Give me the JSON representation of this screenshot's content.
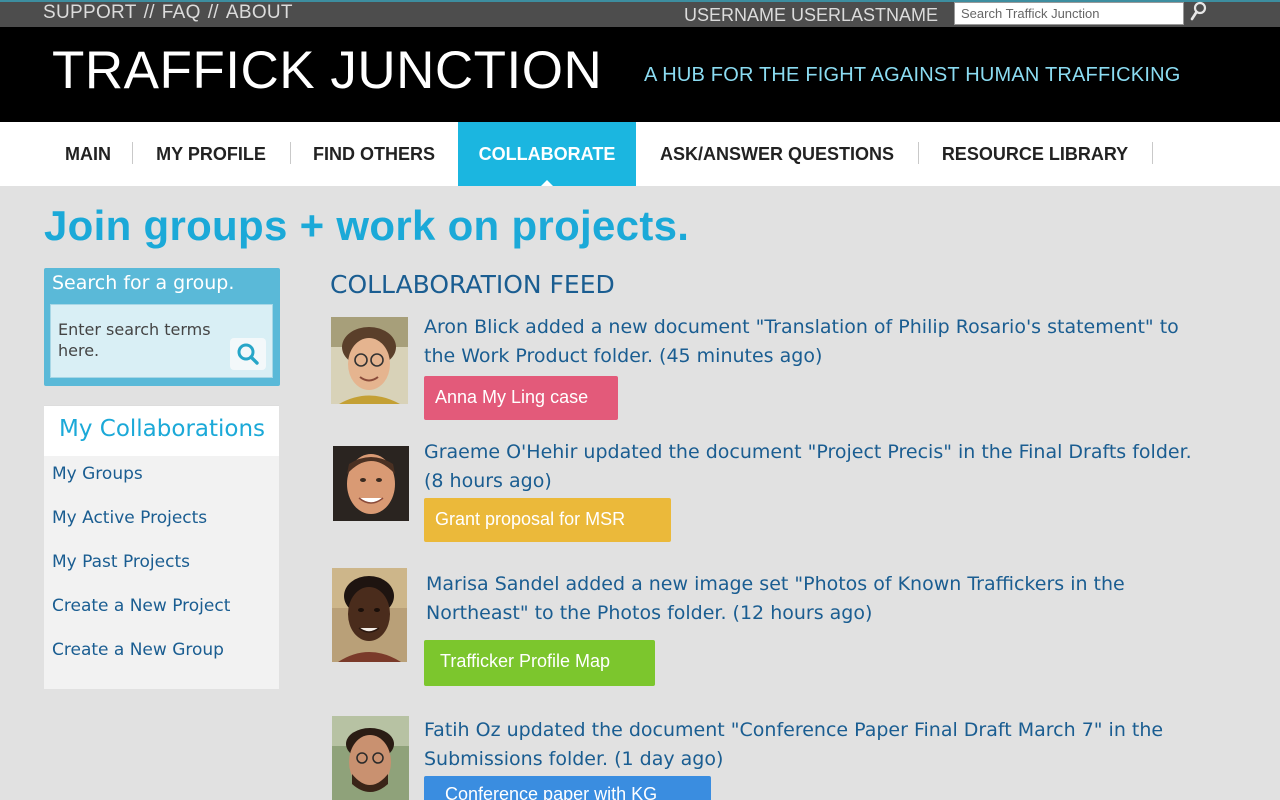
{
  "topbar": {
    "links": [
      "SUPPORT",
      "FAQ",
      "ABOUT"
    ],
    "separator": "//",
    "username": "USERNAME USERLASTNAME",
    "search_placeholder": "Search Traffick Junction"
  },
  "header": {
    "title": "TRAFFICK JUNCTION",
    "tagline": "A HUB FOR THE FIGHT AGAINST HUMAN TRAFFICKING"
  },
  "nav": {
    "items": [
      "MAIN",
      "MY PROFILE",
      "FIND OTHERS",
      "COLLABORATE",
      "ASK/ANSWER QUESTIONS",
      "RESOURCE LIBRARY"
    ],
    "active": "COLLABORATE",
    "active_color": "#1bb6e0"
  },
  "page": {
    "heading": "Join groups + work on projects."
  },
  "group_search": {
    "title": "Search for a group.",
    "placeholder": "Enter search terms here.",
    "icon": "search-icon"
  },
  "collaborations": {
    "title": "My Collaborations",
    "links": [
      "My Groups",
      "My Active Projects",
      "My Past Projects",
      "Create a New Project",
      "Create a New Group"
    ]
  },
  "feed": {
    "title": "COLLABORATION FEED",
    "items": [
      {
        "text": "Aron Blick added a new document \"Translation of Philip Rosario's statement\" to the Work Product folder. (45 minutes ago)",
        "tag": "Anna My Ling case",
        "tag_color": "#e35a7a"
      },
      {
        "text": "Graeme O'Hehir updated the document \"Project Precis\" in the Final Drafts folder. (8 hours ago)",
        "tag": "Grant proposal for MSR",
        "tag_color": "#ebb93a"
      },
      {
        "text": "Marisa Sandel added a new image set \"Photos of Known Traffickers in the Northeast\" to the Photos folder. (12 hours ago)",
        "tag": "Trafficker Profile Map",
        "tag_color": "#7cc62d"
      },
      {
        "text": "Fatih Oz updated the document \"Conference Paper Final Draft March 7\" in the Submissions folder. (1 day ago)",
        "tag": "Conference paper with KG",
        "tag_color": "#3a8de0"
      }
    ]
  }
}
